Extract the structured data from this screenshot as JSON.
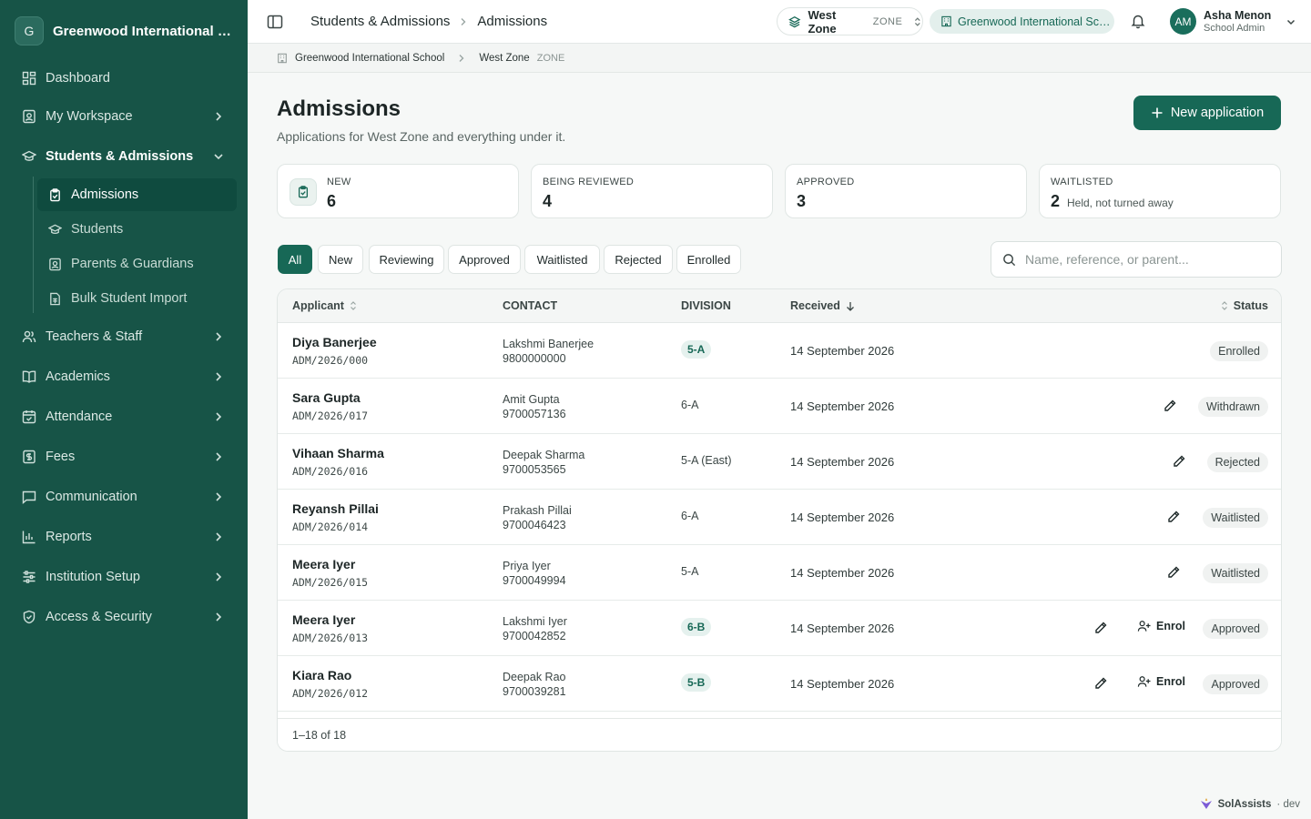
{
  "sidebar": {
    "org_initial": "G",
    "org_name": "Greenwood International School",
    "items": [
      {
        "label": "Dashboard"
      },
      {
        "label": "My Workspace"
      },
      {
        "label": "Students & Admissions"
      },
      {
        "label": "Teachers & Staff"
      },
      {
        "label": "Academics"
      },
      {
        "label": "Attendance"
      },
      {
        "label": "Fees"
      },
      {
        "label": "Communication"
      },
      {
        "label": "Reports"
      },
      {
        "label": "Institution Setup"
      },
      {
        "label": "Access & Security"
      }
    ],
    "sub_items": [
      {
        "label": "Admissions"
      },
      {
        "label": "Students"
      },
      {
        "label": "Parents & Guardians"
      },
      {
        "label": "Bulk Student Import"
      }
    ]
  },
  "topbar": {
    "crumb_parent": "Students & Admissions",
    "crumb_current": "Admissions",
    "zone_name": "West Zone",
    "zone_tag": "ZONE",
    "school_name": "Greenwood International School",
    "user_initials": "AM",
    "user_name": "Asha Menon",
    "user_role": "School Admin"
  },
  "subbar": {
    "school": "Greenwood International School",
    "zone": "West Zone",
    "zone_tag": "ZONE"
  },
  "header": {
    "title": "Admissions",
    "subtitle": "Applications for West Zone and everything under it.",
    "new_button": "New application"
  },
  "stats": [
    {
      "label": "NEW",
      "value": "6"
    },
    {
      "label": "BEING REVIEWED",
      "value": "4"
    },
    {
      "label": "APPROVED",
      "value": "3"
    },
    {
      "label": "WAITLISTED",
      "value": "2",
      "note": "Held, not turned away"
    }
  ],
  "filters": [
    "All",
    "New",
    "Reviewing",
    "Approved",
    "Waitlisted",
    "Rejected",
    "Enrolled"
  ],
  "search": {
    "placeholder": "Name, reference, or parent..."
  },
  "table": {
    "columns": [
      "Applicant",
      "CONTACT",
      "DIVISION",
      "Received",
      "Status"
    ],
    "rows": [
      {
        "name": "Diya Banerjee",
        "ref": "ADM/2026/000",
        "parent": "Lakshmi Banerjee",
        "phone": "9800000000",
        "division": "5-A",
        "date": "14 September 2026",
        "status": "Enrolled",
        "enrol": ""
      },
      {
        "name": "Sara Gupta",
        "ref": "ADM/2026/017",
        "parent": "Amit Gupta",
        "phone": "9700057136",
        "division": "6-A",
        "date": "14 September 2026",
        "status": "Withdrawn",
        "enrol": ""
      },
      {
        "name": "Vihaan Sharma",
        "ref": "ADM/2026/016",
        "parent": "Deepak Sharma",
        "phone": "9700053565",
        "division": "5-A (East)",
        "date": "14 September 2026",
        "status": "Rejected",
        "enrol": ""
      },
      {
        "name": "Reyansh Pillai",
        "ref": "ADM/2026/014",
        "parent": "Prakash Pillai",
        "phone": "9700046423",
        "division": "6-A",
        "date": "14 September 2026",
        "status": "Waitlisted",
        "enrol": ""
      },
      {
        "name": "Meera Iyer",
        "ref": "ADM/2026/015",
        "parent": "Priya Iyer",
        "phone": "9700049994",
        "division": "5-A",
        "date": "14 September 2026",
        "status": "Waitlisted",
        "enrol": ""
      },
      {
        "name": "Meera Iyer",
        "ref": "ADM/2026/013",
        "parent": "Lakshmi Iyer",
        "phone": "9700042852",
        "division": "6-B",
        "date": "14 September 2026",
        "status": "Approved",
        "enrol": "Enrol"
      },
      {
        "name": "Kiara Rao",
        "ref": "ADM/2026/012",
        "parent": "Deepak Rao",
        "phone": "9700039281",
        "division": "5-B",
        "date": "14 September 2026",
        "status": "Approved",
        "enrol": "Enrol"
      }
    ],
    "footer": "1–18 of 18"
  },
  "brand": {
    "name": "SolAssists",
    "env": "· dev"
  },
  "colors": {
    "sidebar": "#175447",
    "accent": "#176856",
    "active": "#0f4b3f"
  }
}
